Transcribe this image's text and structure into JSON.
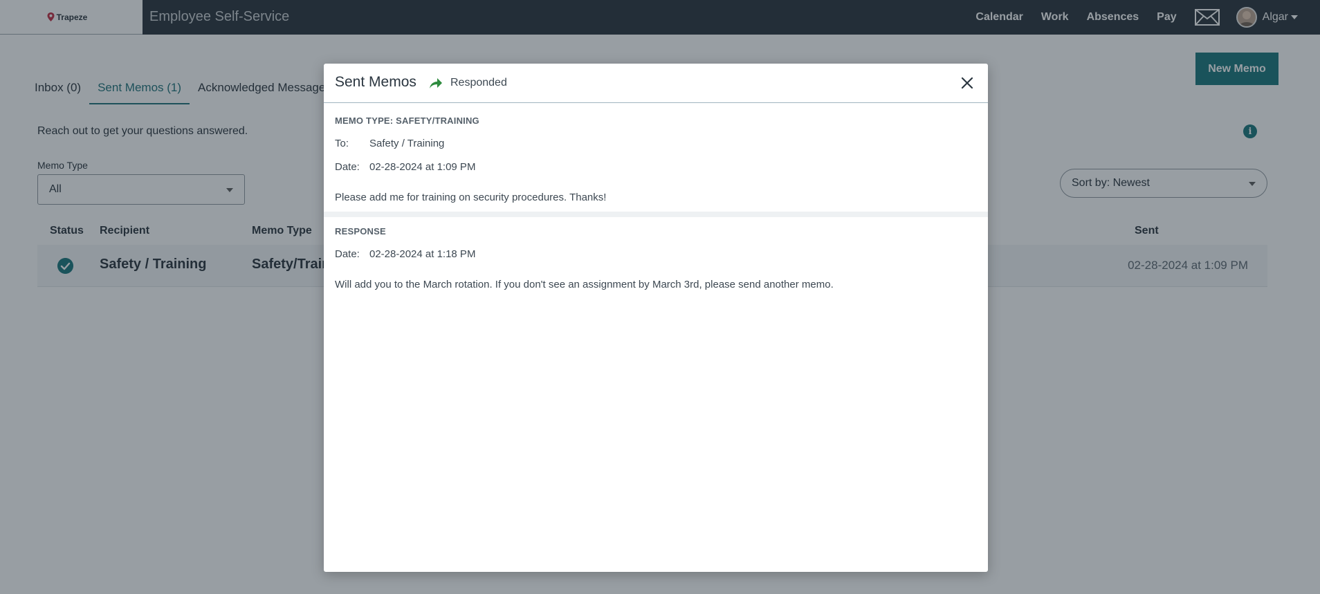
{
  "nav": {
    "logo": "Trapeze",
    "app_title": "Employee Self-Service",
    "links": [
      "Calendar",
      "Work",
      "Absences",
      "Pay"
    ],
    "user": "Algar"
  },
  "tabs": [
    "Inbox (0)",
    "Sent Memos (1)",
    "Acknowledged Message"
  ],
  "new_memo_label": "New Memo",
  "hint": "Reach out to get your questions answered.",
  "filter": {
    "label": "Memo Type",
    "value": "All"
  },
  "sort": {
    "value": "Sort by: Newest"
  },
  "table": {
    "headers": {
      "status": "Status",
      "recipient": "Recipient",
      "memo_type": "Memo Type",
      "sent": "Sent"
    },
    "rows": [
      {
        "recipient": "Safety / Training",
        "memo_type": "Safety/Train",
        "sent": "02-28-2024 at 1:09 PM"
      }
    ]
  },
  "modal": {
    "title": "Sent Memos",
    "status": "Responded",
    "memo": {
      "type_label": "MEMO TYPE: SAFETY/TRAINING",
      "to_key": "To:",
      "to_value": "Safety / Training",
      "date_key": "Date:",
      "date_value": "02-28-2024 at 1:09 PM",
      "body": "Please add me for training on security procedures. Thanks!"
    },
    "response": {
      "label": "RESPONSE",
      "date_key": "Date:",
      "date_value": "02-28-2024 at 1:18 PM",
      "body": "Will add you to the March rotation. If you don't see an assignment by March 3rd, please send another memo."
    }
  },
  "colors": {
    "nav_bg": "#1f2a33",
    "accent": "#0e6f75",
    "responded_green": "#2e8b3e"
  }
}
